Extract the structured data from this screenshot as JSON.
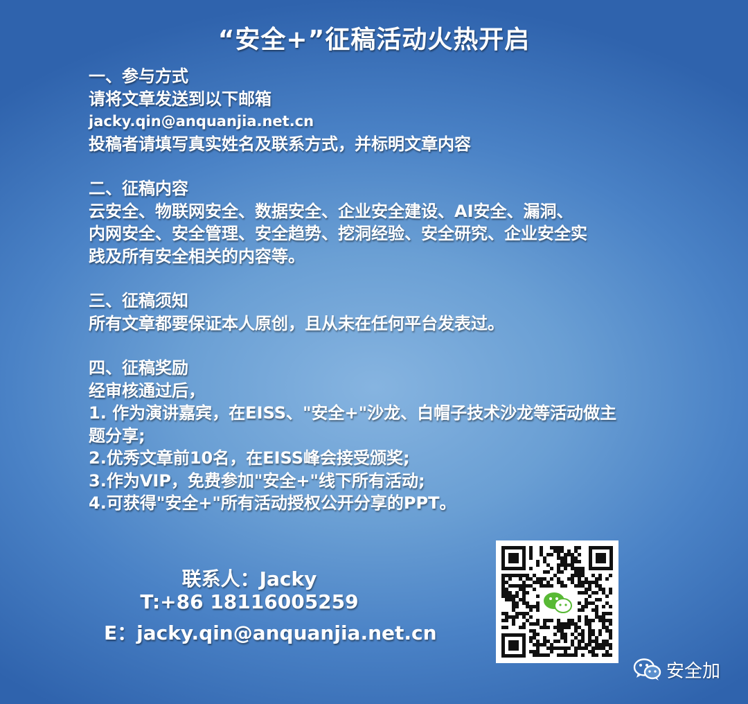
{
  "title": "“安全+”征稿活动火热开启",
  "sections": {
    "s1": {
      "heading": "一、参与方式",
      "line1": "请将文章发送到以下邮箱",
      "email": "jacky.qin@anquanjia.net.cn",
      "line3": "投稿者请填写真实姓名及联系方式，并标明文章内容"
    },
    "s2": {
      "heading": "二、征稿内容",
      "line1": "云安全、物联网安全、数据安全、企业安全建设、AI安全、漏洞、",
      "line2": "内网安全、安全管理、安全趋势、挖洞经验、安全研究、企业安全实",
      "line3": "践及所有安全相关的内容等。"
    },
    "s3": {
      "heading": "三、征稿须知",
      "line1": "所有文章都要保证本人原创，且从未在任何平台发表过。"
    },
    "s4": {
      "heading": "四、征稿奖励",
      "line1": "经审核通过后，",
      "line2": "1. 作为演讲嘉宾，在EISS、\"安全+\"沙龙、白帽子技术沙龙等活动做主",
      "line3": "题分享;",
      "line4": "2.优秀文章前10名，在EISS峰会接受颁奖;",
      "line5": "3.作为VIP，免费参加\"安全+\"线下所有活动;",
      "line6": "4.可获得\"安全+\"所有活动授权公开分享的PPT。"
    }
  },
  "contact": {
    "name": "联系人：Jacky",
    "phone": "T:+86 18116005259",
    "email": "E：jacky.qin@anquanjia.net.cn"
  },
  "qr": {
    "center_icon": "wechat-icon"
  },
  "badge": {
    "icon": "wechat-icon",
    "label": "安全加"
  },
  "colors": {
    "bg_center": "#86b4e0",
    "bg_edge": "#2f63ad",
    "text": "#ffffff",
    "wechat_green": "#58b935"
  }
}
